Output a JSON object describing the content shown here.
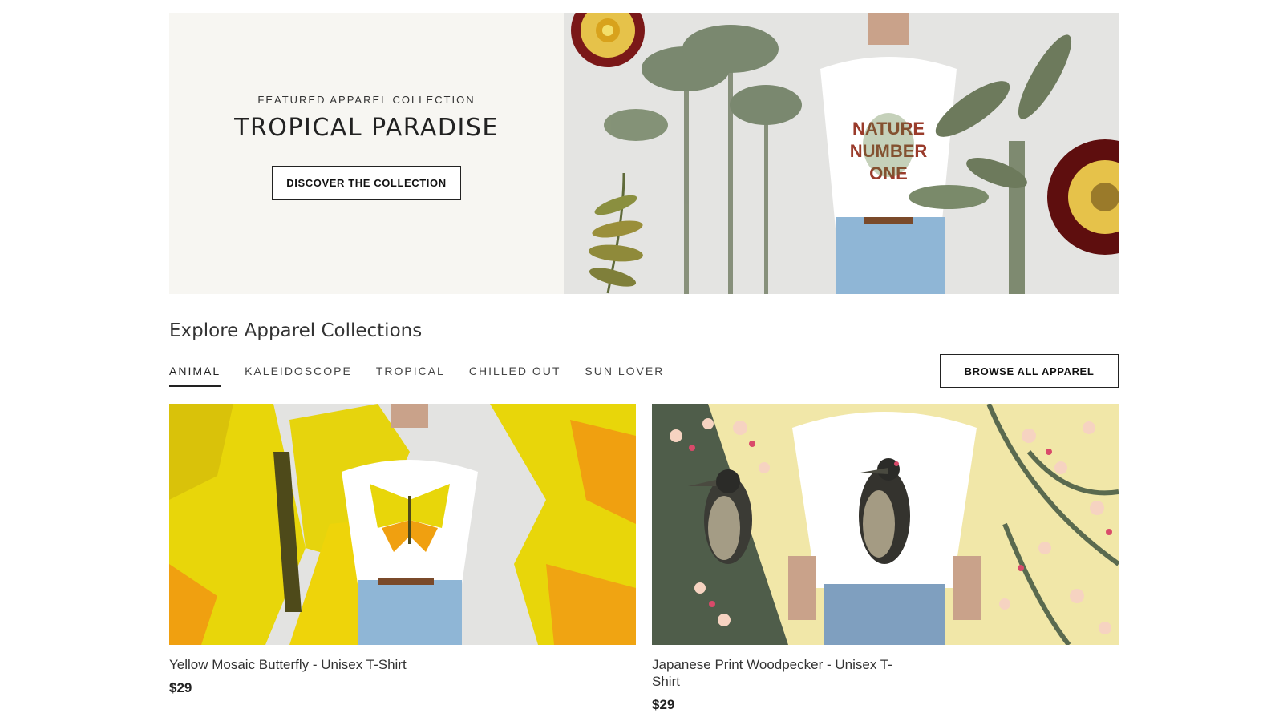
{
  "hero": {
    "kicker": "FEATURED APPAREL COLLECTION",
    "title": "TROPICAL PARADISE",
    "button_label": "DISCOVER THE COLLECTION",
    "shirt_text": [
      "NATURE",
      "NUMBER",
      "ONE"
    ]
  },
  "section": {
    "title": "Explore Apparel Collections",
    "browse_label": "BROWSE ALL APPAREL",
    "tabs": [
      {
        "label": "ANIMAL",
        "active": true
      },
      {
        "label": "KALEIDOSCOPE",
        "active": false
      },
      {
        "label": "TROPICAL",
        "active": false
      },
      {
        "label": "CHILLED OUT",
        "active": false
      },
      {
        "label": "SUN LOVER",
        "active": false
      }
    ]
  },
  "products": [
    {
      "name": "Yellow Mosaic Butterfly - Unisex T-Shirt",
      "price": "$29"
    },
    {
      "name": "Japanese Print Woodpecker - Unisex T-Shirt",
      "price": "$29"
    }
  ],
  "colors": {
    "hero_bg": "#f7f6f2",
    "butterfly_yellow": "#e8d60a",
    "butterfly_orange": "#f0a010",
    "sakura_bg": "#f1e7a8",
    "foliage": "#6f7f63",
    "flower_red": "#7a1818"
  }
}
